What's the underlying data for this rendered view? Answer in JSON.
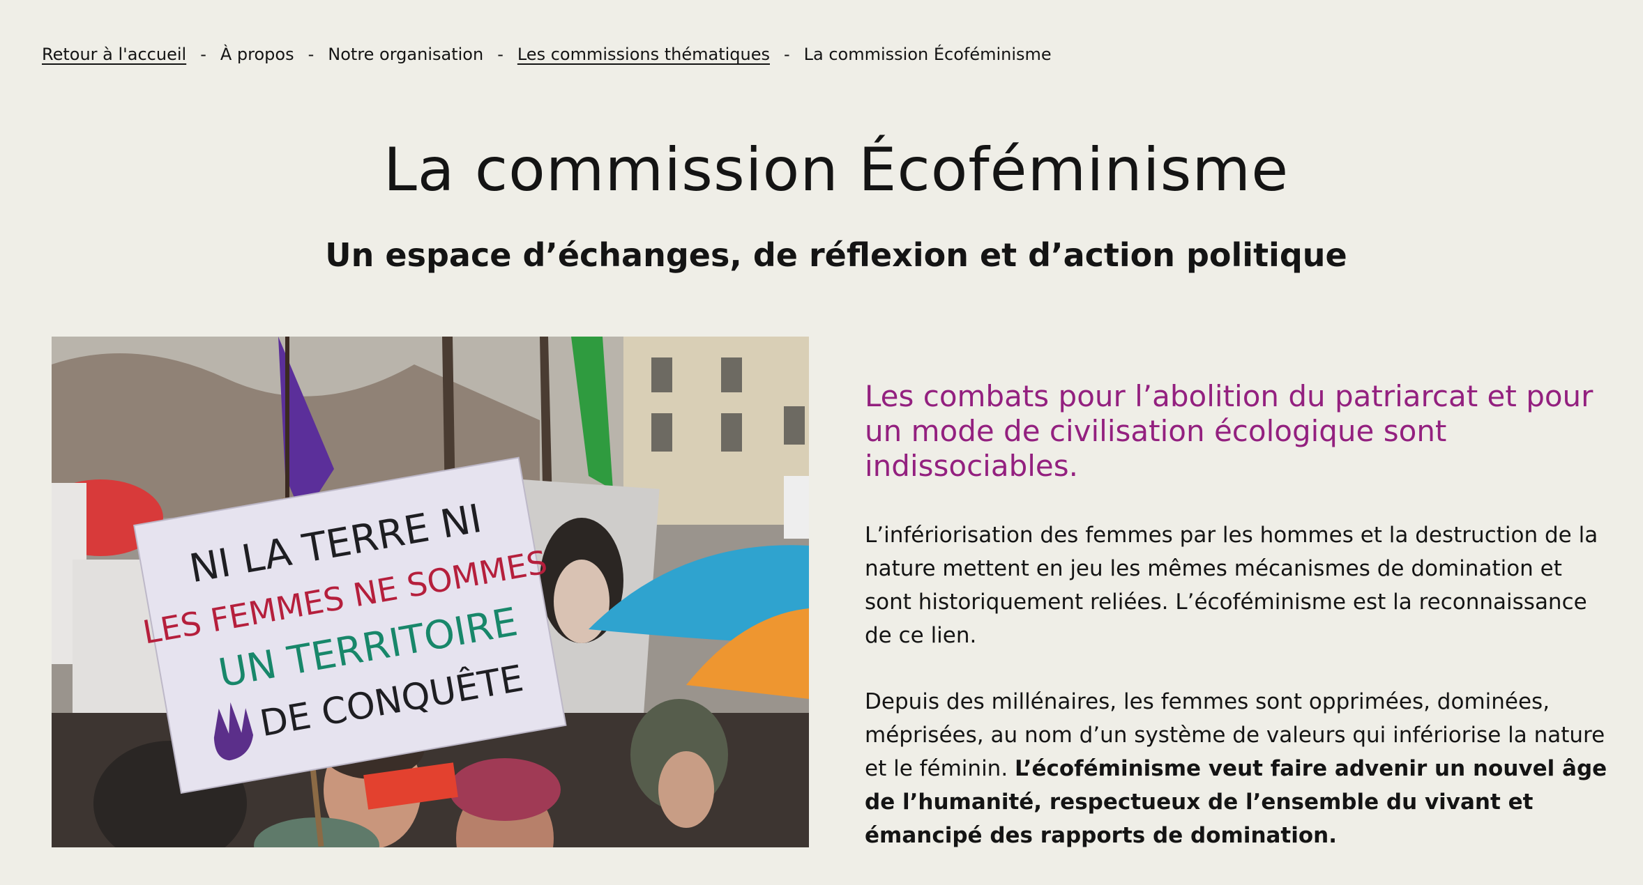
{
  "breadcrumb": {
    "items": [
      {
        "label": "Retour à l'accueil",
        "link": true
      },
      {
        "label": "À propos",
        "link": false
      },
      {
        "label": "Notre organisation",
        "link": false
      },
      {
        "label": "Les commissions thématiques",
        "link": true
      },
      {
        "label": "La commission Écoféminisme",
        "link": false
      }
    ],
    "separator": "-"
  },
  "page": {
    "title": "La commission Écoféminisme",
    "subtitle": "Un espace d’échanges, de réflexion et d’action politique"
  },
  "photo": {
    "sign_lines": [
      "NI LA TERRE NI",
      "LES FEMMES NE SOMMES",
      "UN TERRITOIRE",
      "DE CONQUÊTE"
    ]
  },
  "content": {
    "lead": "Les combats pour l’abolition du patriarcat et pour un mode de civilisation écologique sont indissociables.",
    "para1": "L’infériorisation des femmes par les hommes et la destruction de la nature mettent en jeu les mêmes mécanismes de domination et sont historiquement reliées. L’écoféminisme est la reconnaissance de ce lien.",
    "para2_intro": "Depuis des millénaires, les femmes sont opprimées, dominées, méprisées, au nom d’un système de valeurs qui infériorise la nature et le féminin.",
    "para2_bold": "L’écoféminisme veut faire advenir un nouvel âge de l’humanité, respectueux de l’ensemble du vivant et émancipé des rapports de domination."
  },
  "colors": {
    "background": "#efeee7",
    "accent": "#93207f",
    "text": "#141414"
  }
}
